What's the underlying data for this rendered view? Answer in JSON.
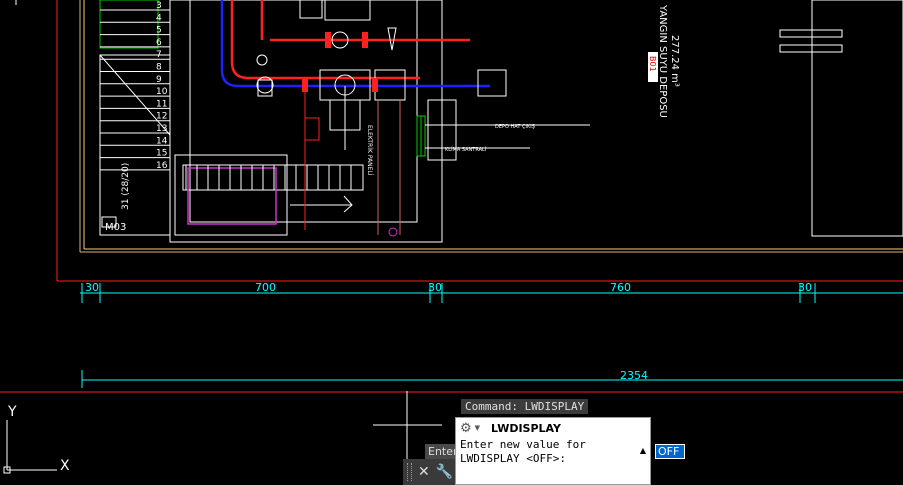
{
  "dimensions": {
    "top": [
      "30",
      "700",
      "30",
      "760",
      "30"
    ],
    "total": "2354"
  },
  "drawing": {
    "stair_numbers": [
      "3",
      "4",
      "5",
      "6",
      "7",
      "8",
      "9",
      "10",
      "11",
      "12",
      "13",
      "14",
      "15",
      "16"
    ],
    "room_label": "M03",
    "stair_note": "31 (28/20)",
    "tank_label": "YANGIN SUYU DEPOSU",
    "tank_volume": "277.24 m³",
    "tank_code": "B01",
    "vertical_label": "ELEKTRİK PANELİ",
    "side_notes": [
      "DEPO HAT ÇIKIŞ",
      "KLİMA SANTRALİ"
    ],
    "ucs_axes": [
      "Y",
      "X"
    ]
  },
  "command": {
    "history": "Command: LWDISPLAY",
    "enter_hint": "Enter",
    "prompt_title": "LWDISPLAY",
    "prompt_line1": "Enter new value for",
    "prompt_line2": "LWDISPLAY <OFF>:",
    "input_value": "OFF"
  },
  "icons": [
    "settings-gear-icon",
    "close-icon",
    "customize-wrench-icon",
    "scroll-up-icon"
  ],
  "colors": {
    "background": "#000000",
    "dimension": "#00ffff",
    "pipe_red": "#ff2020",
    "pipe_blue": "#2020ff",
    "selection": "#0066cc"
  }
}
